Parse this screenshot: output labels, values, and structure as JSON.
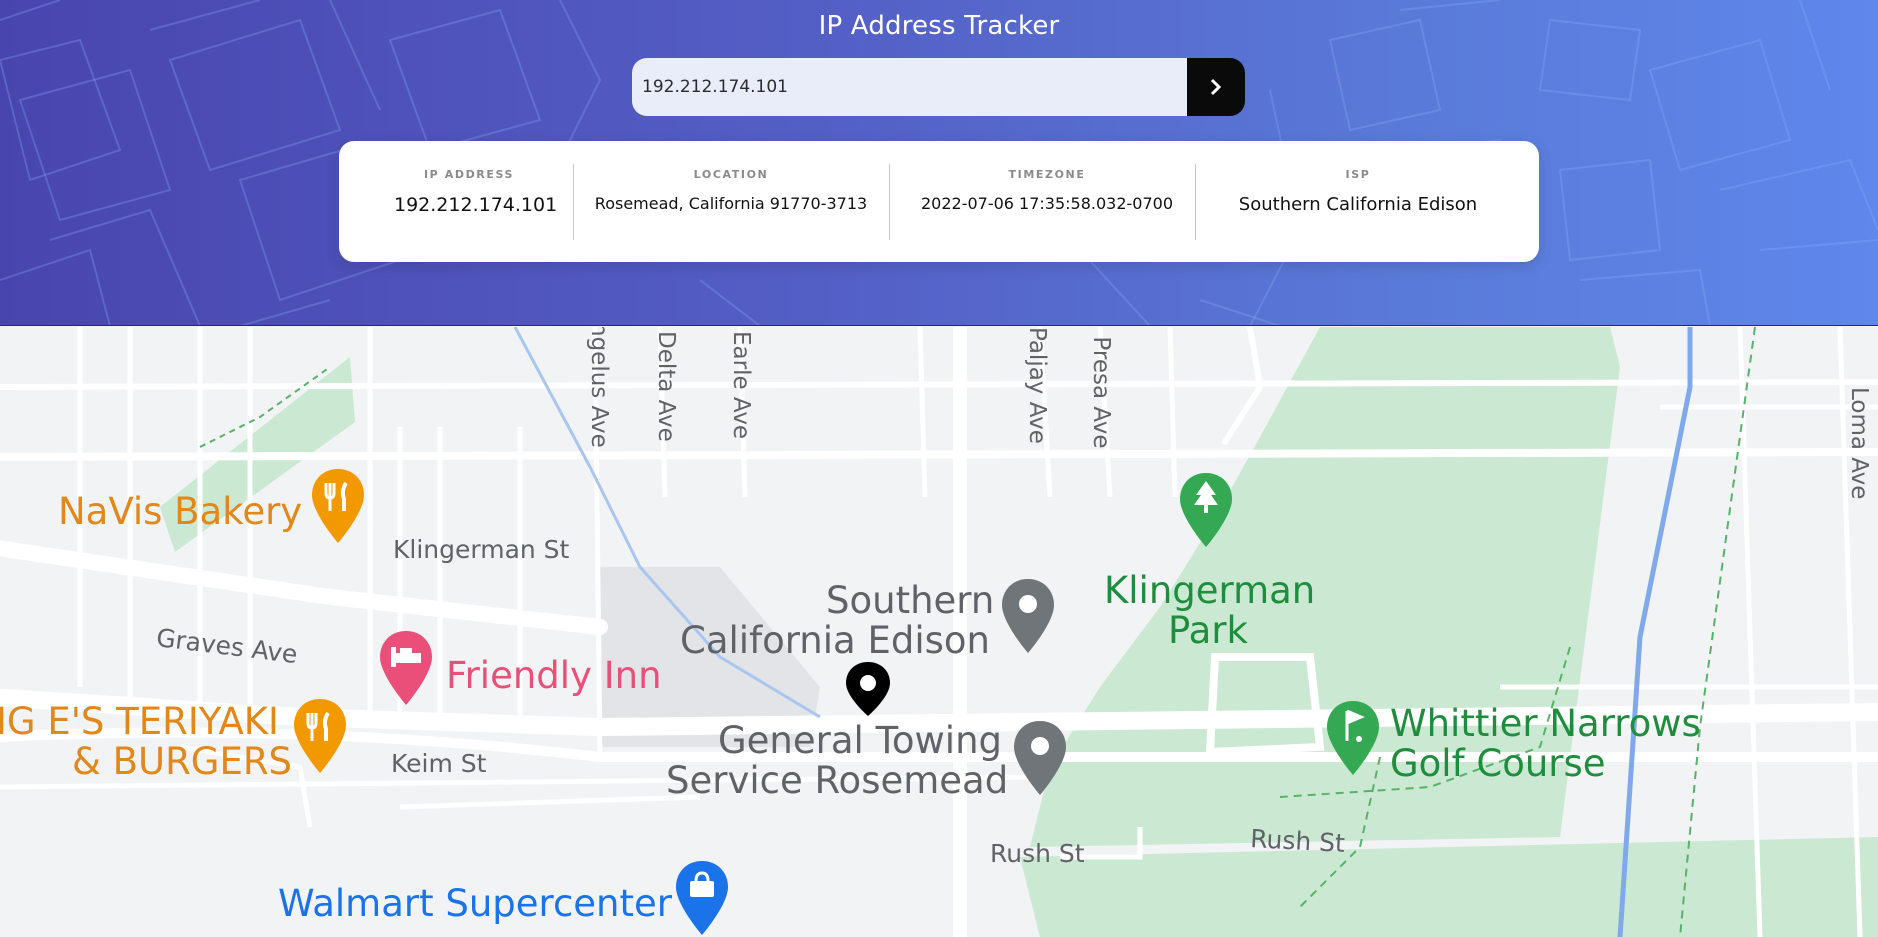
{
  "app": {
    "title": "IP Address Tracker"
  },
  "search": {
    "value": "192.212.174.101",
    "submit_icon": "chevron-right-icon"
  },
  "info": {
    "ip": {
      "label": "IP ADDRESS",
      "value": "192.212.174.101"
    },
    "location": {
      "label": "LOCATION",
      "value": "Rosemead, California 91770-3713"
    },
    "timezone": {
      "label": "TIMEZONE",
      "value": "2022-07-06 17:35:58.032-0700"
    },
    "isp": {
      "label": "ISP",
      "value": "Southern California Edison"
    }
  },
  "map": {
    "streets": {
      "klingerman_st": "Klingerman St",
      "graves_ave": "Graves Ave",
      "keim_st": "Keim St",
      "rush_st_west": "Rush St",
      "rush_st_east": "Rush St",
      "angelus_ave": "ngelus Ave",
      "delta_ave": "Delta Ave",
      "earle_ave": "Earle Ave",
      "paljay_ave": "Paljay Ave",
      "la_presa_ave": "a Presa Ave",
      "loma_ave": "Loma Ave"
    },
    "places": {
      "navis_bakery": "NaVis Bakery",
      "friendly_inn": "Friendly Inn",
      "teriyaki_1": "IG E'S TERIYAKI",
      "teriyaki_2": "& BURGERS",
      "sce_1": "Southern",
      "sce_2": "California Edison",
      "towing_1": "General Towing",
      "towing_2": "Service Rosemead",
      "park_1": "Klingerman",
      "park_2": "Park",
      "golf_1": "Whittier Narrows",
      "golf_2": "Golf Course",
      "walmart": "Walmart Supercenter"
    },
    "colors": {
      "restaurant": "#f29900",
      "hotel": "#e94f78",
      "generic": "#70757a",
      "park": "#34a853",
      "shopping": "#1a73e8",
      "marker": "#000000"
    },
    "marker_icon": "location-marker-icon"
  }
}
